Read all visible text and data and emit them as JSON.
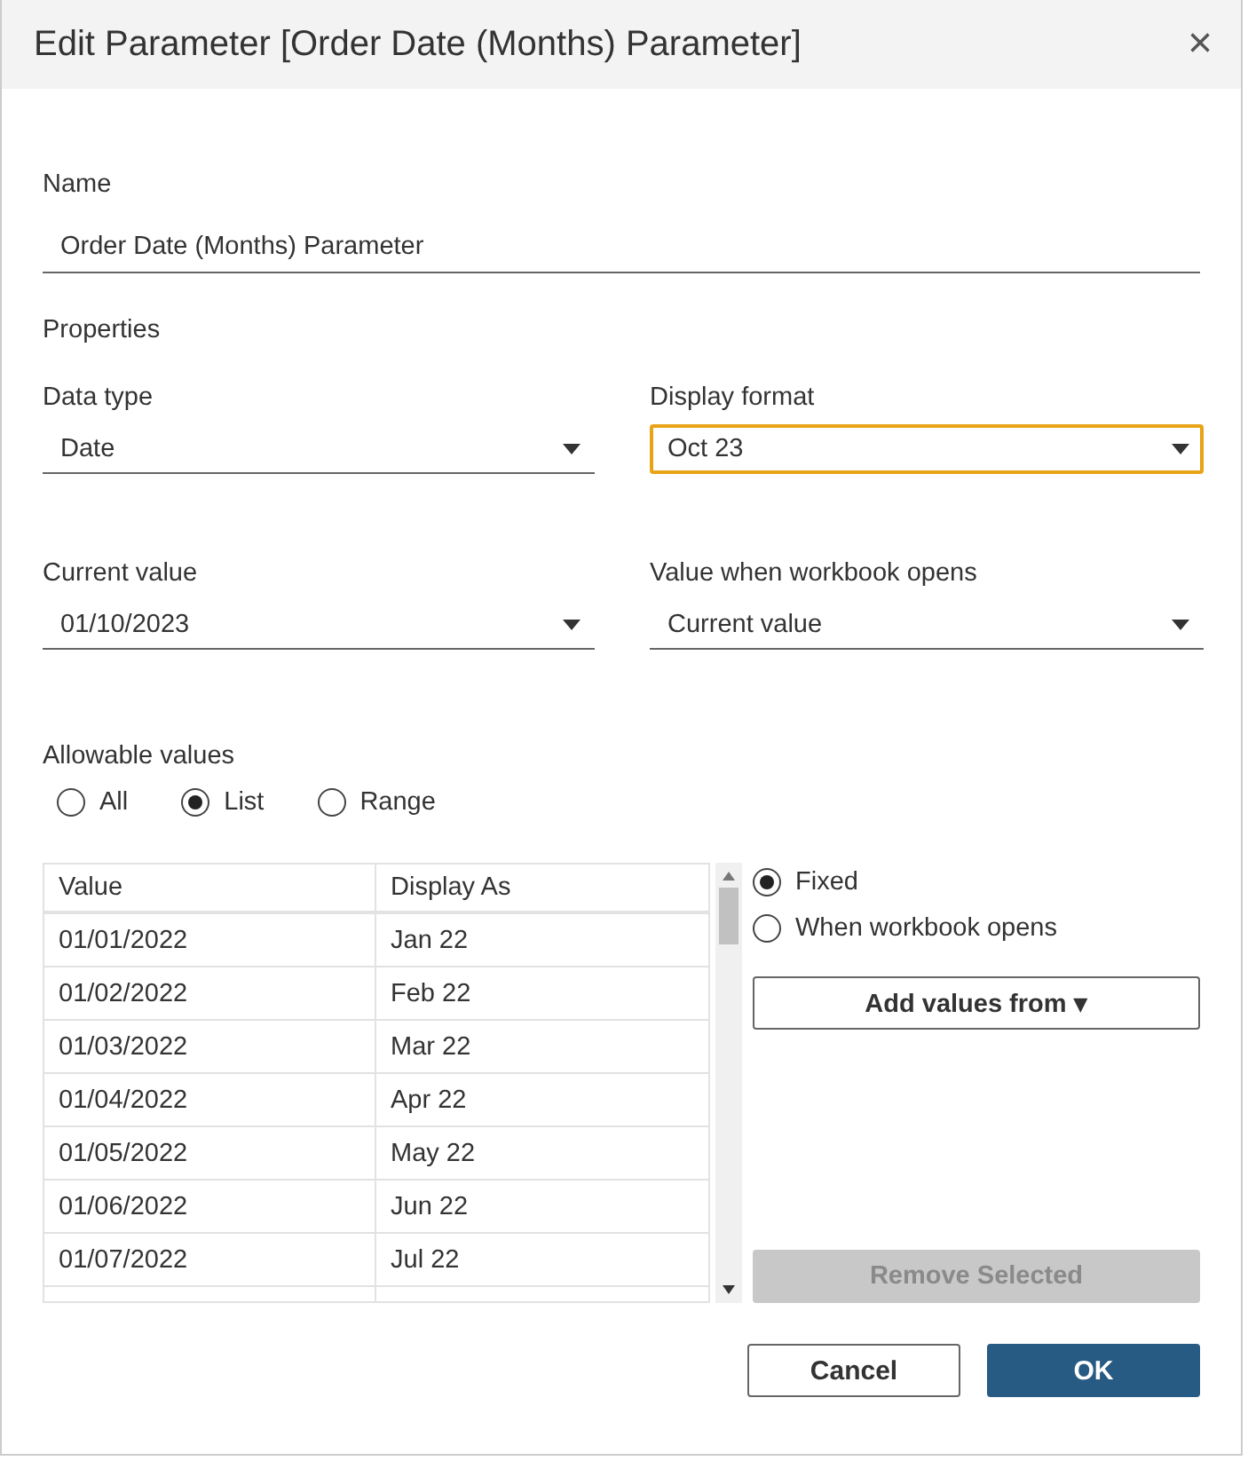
{
  "window": {
    "title": "Edit Parameter [Order Date (Months) Parameter]",
    "close": "×"
  },
  "name": {
    "label": "Name",
    "value": "Order Date (Months) Parameter"
  },
  "properties": {
    "heading": "Properties",
    "fields": [
      {
        "label": "Data type",
        "value": "Date",
        "focused": false
      },
      {
        "label": "Display format",
        "value": "Oct 23",
        "focused": true
      },
      {
        "label": "Current value",
        "value": "01/10/2023",
        "focused": false
      },
      {
        "label": "Value when workbook opens",
        "value": "Current value",
        "focused": false
      }
    ]
  },
  "allowable_values": {
    "label": "Allowable values",
    "options": [
      {
        "label": "All",
        "selected": false
      },
      {
        "label": "List",
        "selected": true
      },
      {
        "label": "Range",
        "selected": false
      }
    ]
  },
  "table": {
    "columns": [
      "Value",
      "Display As"
    ],
    "rows": [
      [
        "01/01/2022",
        "Jan 22"
      ],
      [
        "01/02/2022",
        "Feb 22"
      ],
      [
        "01/03/2022",
        "Mar 22"
      ],
      [
        "01/04/2022",
        "Apr 22"
      ],
      [
        "01/05/2022",
        "May 22"
      ],
      [
        "01/06/2022",
        "Jun 22"
      ],
      [
        "01/07/2022",
        "Jul 22"
      ]
    ]
  },
  "list_source": {
    "options": [
      {
        "label": "Fixed",
        "selected": true
      },
      {
        "label": "When workbook opens",
        "selected": false
      }
    ],
    "add_button": "Add values from ▾",
    "remove_button": {
      "label": "Remove Selected",
      "disabled": true
    }
  },
  "buttons": [
    {
      "label": "Cancel",
      "kind": "secondary"
    },
    {
      "label": "OK",
      "kind": "primary"
    }
  ]
}
